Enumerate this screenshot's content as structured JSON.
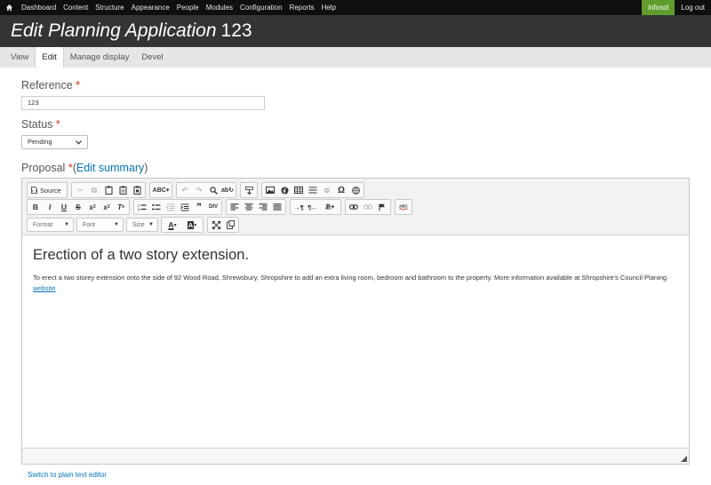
{
  "toolbar": {
    "menu": [
      "Dashboard",
      "Content",
      "Structure",
      "Appearance",
      "People",
      "Modules",
      "Configuration",
      "Reports",
      "Help"
    ],
    "user": "infosol",
    "logout": "Log out"
  },
  "header": {
    "title_italic": "Edit Planning Application",
    "title_rest": "123"
  },
  "tabs": [
    "View",
    "Edit",
    "Manage display",
    "Devel"
  ],
  "form": {
    "reference_label": "Reference",
    "reference_value": "123",
    "status_label": "Status",
    "status_value": "Pending",
    "proposal_label": "Proposal",
    "edit_summary": "Edit summary",
    "required_mark": "*"
  },
  "editor": {
    "source_label": "Source",
    "format_label": "Format",
    "font_label": "Font",
    "size_label": "Size",
    "heading": "Erection of a two story extension.",
    "body_text": "To erect a two storey extension onto the side of 92 Wood Road, Shrewsbury, Shropshire to add an extra living room, bedroom and bathroom to the property. More information available at Shropshire's Council Planing",
    "link_text": "website",
    "switch_link": "Switch to plain text editor"
  },
  "colors": {
    "toolbar_bg": "#0f0f0f",
    "header_bg": "#333435",
    "user_badge": "#5f9e2c",
    "link": "#0074bd",
    "required": "#e32700"
  }
}
